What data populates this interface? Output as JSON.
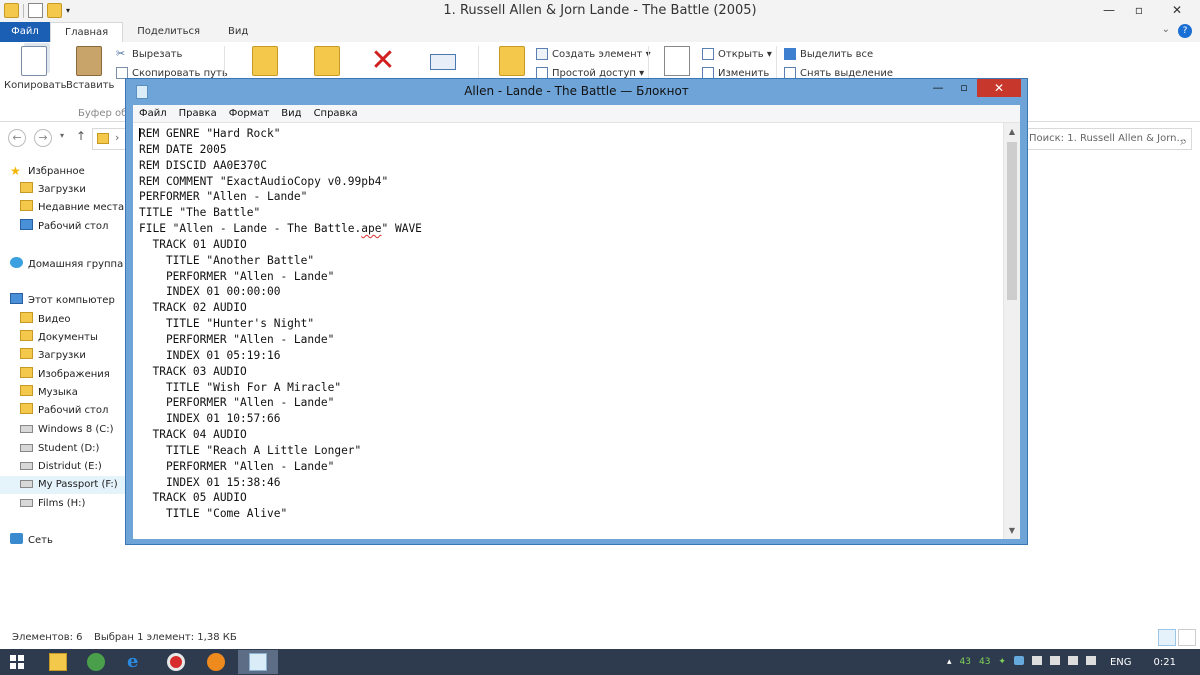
{
  "explorer": {
    "window_title": "1. Russell Allen & Jorn Lande - The Battle (2005)",
    "tabs": [
      "Файл",
      "Главная",
      "Поделиться",
      "Вид"
    ],
    "ribbon": {
      "copy": "Копировать",
      "paste": "Вставить",
      "cut": "Вырезать",
      "copy_path": "Скопировать путь",
      "clipboard_group": "Буфер обм",
      "new_item": "Создать элемент ▾",
      "easy_access": "Простой доступ ▾",
      "open": "Открыть ▾",
      "edit": "Изменить",
      "select_all": "Выделить все",
      "deselect": "Снять выделение"
    },
    "search_placeholder": "Поиск: 1. Russell Allen & Jorn...",
    "nav": {
      "favorites": "Избранное",
      "downloads": "Загрузки",
      "recent": "Недавние места",
      "desktop": "Рабочий стол",
      "homegroup": "Домашняя группа",
      "this_pc": "Этот компьютер",
      "videos": "Видео",
      "documents": "Документы",
      "downloads2": "Загрузки",
      "pictures": "Изображения",
      "music": "Музыка",
      "desktop2": "Рабочий стол",
      "drive_c": "Windows 8 (C:)",
      "drive_d": "Student (D:)",
      "drive_e": "Distridut (E:)",
      "drive_f": "My Passport (F:)",
      "drive_h": "Films (H:)",
      "network": "Сеть"
    },
    "status": {
      "items": "Элементов: 6",
      "selected": "Выбран 1 элемент: 1,38 КБ"
    }
  },
  "notepad": {
    "title": "Allen - Lande - The Battle — Блокнот",
    "menu": [
      "Файл",
      "Правка",
      "Формат",
      "Вид",
      "Справка"
    ],
    "lines_before": [
      "REM GENRE \"Hard Rock\"",
      "REM DATE 2005",
      "REM DISCID AA0E370C",
      "REM COMMENT \"ExactAudioCopy v0.99pb4\"",
      "PERFORMER \"Allen - Lande\"",
      "TITLE \"The Battle\""
    ],
    "file_line": {
      "prefix": "FILE \"Allen - Lande - The Battle.",
      "underlined": "ape",
      "suffix": "\" WAVE"
    },
    "lines_after": [
      "  TRACK 01 AUDIO",
      "    TITLE \"Another Battle\"",
      "    PERFORMER \"Allen - Lande\"",
      "    INDEX 01 00:00:00",
      "  TRACK 02 AUDIO",
      "    TITLE \"Hunter's Night\"",
      "    PERFORMER \"Allen - Lande\"",
      "    INDEX 01 05:19:16",
      "  TRACK 03 AUDIO",
      "    TITLE \"Wish For A Miracle\"",
      "    PERFORMER \"Allen - Lande\"",
      "    INDEX 01 10:57:66",
      "  TRACK 04 AUDIO",
      "    TITLE \"Reach A Little Longer\"",
      "    PERFORMER \"Allen - Lande\"",
      "    INDEX 01 15:38:46",
      "  TRACK 05 AUDIO",
      "    TITLE \"Come Alive\""
    ]
  },
  "taskbar": {
    "tray_num1": "43",
    "tray_num2": "43",
    "language": "ENG",
    "clock": "0:21"
  }
}
